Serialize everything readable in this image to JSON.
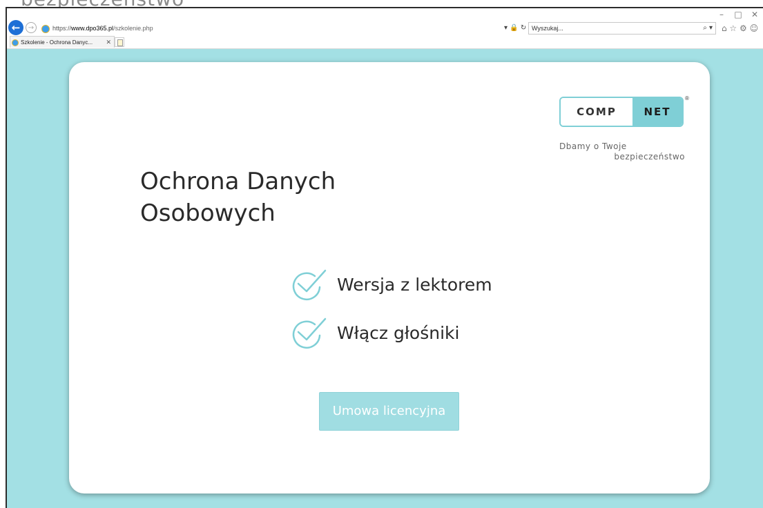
{
  "background": {
    "tagline": "bezpieczeństwo"
  },
  "browser": {
    "window_controls": {
      "minimize": "–",
      "maximize": "□",
      "close": "✕"
    },
    "nav": {
      "back_icon": "arrow-left-icon",
      "forward_icon": "arrow-right-icon"
    },
    "address": {
      "protocol": "https://",
      "host": "www.dpo365.pl",
      "path": "/szkolenie.php",
      "tools": "▾ 🔒 ↻"
    },
    "search": {
      "placeholder": "Wyszukaj...",
      "icon": "⌕ ▾"
    },
    "toolbar": {
      "icons": "⌂ ☆ ⚙ ☺"
    },
    "tabs": [
      {
        "label": "Szkolenie - Ochrona Danyc...",
        "close": "✕",
        "active": true
      }
    ]
  },
  "page": {
    "logo": {
      "left_text": "COMP",
      "right_text": "NET",
      "reg": "®"
    },
    "slogan": {
      "line1": "Dbamy o Twoje",
      "line2": "bezpieczeństwo"
    },
    "title": {
      "line1": "Ochrona Danych",
      "line2": "Osobowych"
    },
    "features": [
      {
        "text": "Wersja z lektorem"
      },
      {
        "text": "Włącz głośniki"
      }
    ],
    "license_button": "Umowa licencyjna"
  },
  "colors": {
    "accent": "#7fcfd6",
    "page_background": "#a3e0e4",
    "button": "#a0dde2",
    "title_text": "#2a2a2a"
  }
}
